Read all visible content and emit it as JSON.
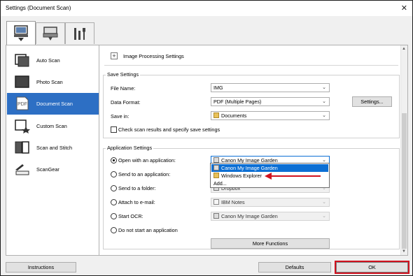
{
  "window": {
    "title": "Settings (Document Scan)"
  },
  "tabs": [
    {
      "icon": "scan-from-computer-icon",
      "active": true
    },
    {
      "icon": "scan-from-operation-panel-icon",
      "active": false
    },
    {
      "icon": "general-settings-tools-icon",
      "active": false
    }
  ],
  "sidebar": {
    "items": [
      {
        "label": "Auto Scan",
        "icon": "auto-scan-icon",
        "selected": false
      },
      {
        "label": "Photo Scan",
        "icon": "photo-scan-icon",
        "selected": false
      },
      {
        "label": "Document Scan",
        "icon": "pdf-document-icon",
        "selected": true
      },
      {
        "label": "Custom Scan",
        "icon": "custom-scan-icon",
        "selected": false
      },
      {
        "label": "Scan and Stitch",
        "icon": "scan-and-stitch-icon",
        "selected": false
      },
      {
        "label": "ScanGear",
        "icon": "scangear-icon",
        "selected": false
      }
    ]
  },
  "image_processing": {
    "toggle": "+",
    "label": "Image Processing Settings"
  },
  "save_settings": {
    "title": "Save Settings",
    "file_name_label": "File Name:",
    "file_name_value": "IMG",
    "data_format_label": "Data Format:",
    "data_format_value": "PDF (Multiple Pages)",
    "settings_button": "Settings...",
    "save_in_label": "Save in:",
    "save_in_value": "Documents",
    "check_label": "Check scan results and specify save settings"
  },
  "application_settings": {
    "title": "Application Settings",
    "open_app_label": "Open with an application:",
    "open_app_value": "Canon My Image Garden",
    "send_app_label": "Send to an application:",
    "send_folder_label": "Send to a folder:",
    "send_folder_value": "Dropbox",
    "email_label": "Attach to e-mail:",
    "email_value": "IBM Notes",
    "ocr_label": "Start OCR:",
    "ocr_value": "Canon My Image Garden",
    "none_label": "Do not start an application",
    "more_functions": "More Functions",
    "dropdown_options": [
      "Canon My Image Garden",
      "Windows Explorer",
      "Add..."
    ],
    "dropdown_selected": "Canon My Image Garden"
  },
  "buttons": {
    "instructions": "Instructions",
    "defaults": "Defaults",
    "ok": "OK"
  },
  "colors": {
    "selection": "#2d6fc4",
    "highlight_box": "#d0121f",
    "annotation_arrow": "#d0121f"
  }
}
